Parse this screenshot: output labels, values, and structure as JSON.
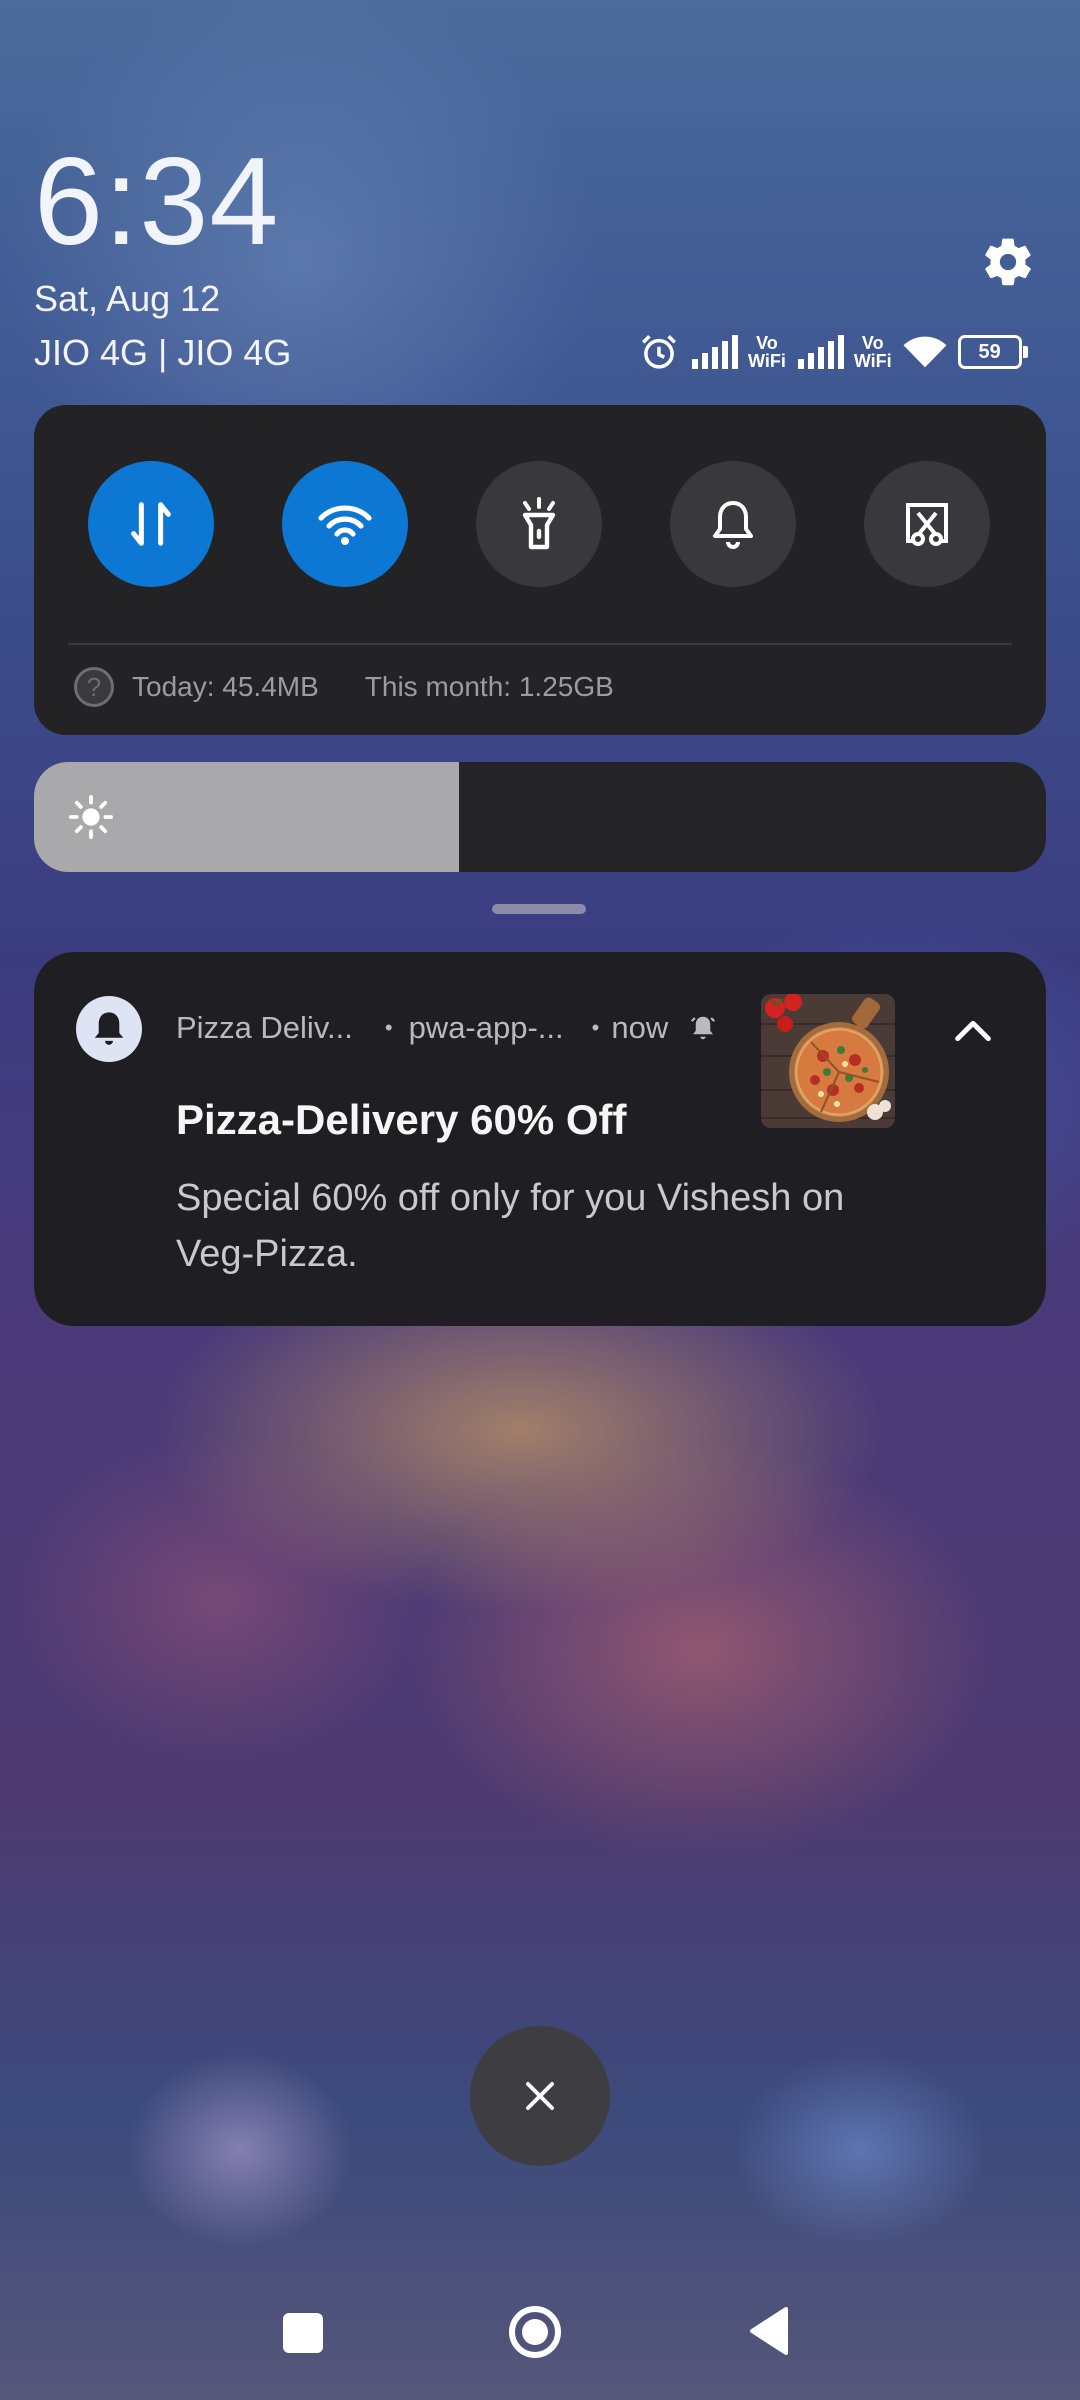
{
  "header": {
    "time": "6:34",
    "date": "Sat, Aug 12",
    "carrier": "JIO 4G | JIO 4G",
    "status_icons": [
      "alarm-icon",
      "signal-icon",
      "vowifi-icon",
      "signal-icon",
      "vowifi-icon",
      "wifi-icon",
      "battery-icon"
    ],
    "vowifi_label_top": "Vo",
    "vowifi_label_bottom": "WiFi",
    "battery_level": "59"
  },
  "quick_settings": {
    "tiles": [
      {
        "name": "mobile-data",
        "icon": "mobile-data-icon",
        "active": true
      },
      {
        "name": "wifi",
        "icon": "wifi-icon",
        "active": true
      },
      {
        "name": "flashlight",
        "icon": "flashlight-icon",
        "active": false
      },
      {
        "name": "notifications",
        "icon": "bell-icon",
        "active": false
      },
      {
        "name": "screenshot",
        "icon": "screenshot-icon",
        "active": false
      }
    ],
    "data_today": "Today: 45.4MB",
    "data_month": "This month: 1.25GB"
  },
  "brightness": {
    "level": 0.42
  },
  "notification": {
    "app_name": "Pizza Deliv...",
    "source": "pwa-app-...",
    "time": "now",
    "title": "Pizza-Delivery 60% Off",
    "body": "Special 60% off only for you Vishesh on Veg-Pizza.",
    "separator": "•"
  },
  "colors": {
    "accent": "#0d78d4",
    "panel": "#232326",
    "notification_bg": "#1f1f23"
  }
}
